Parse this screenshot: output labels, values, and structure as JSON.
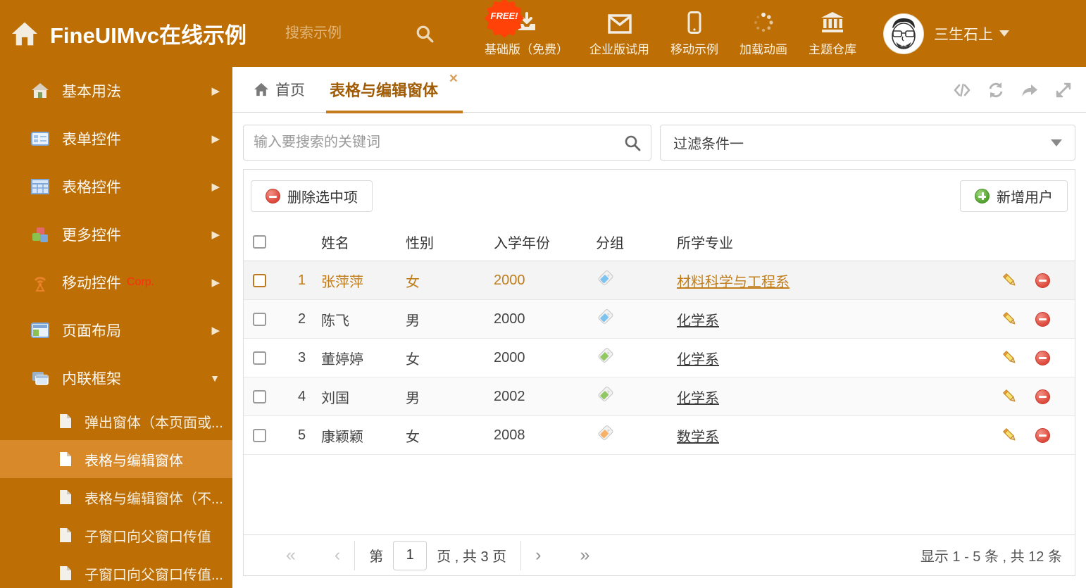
{
  "theme": {
    "header_bg": "#bd6e04",
    "sidebar_active_bg": "#d8892a",
    "free_badge_red": "#ff4208",
    "tab_active_color": "#a05c04",
    "selected_row_color": "#c07d1a"
  },
  "header": {
    "title": "FineUIMvc在线示例",
    "search_placeholder": "搜索示例",
    "free_badge": "FREE!",
    "nav": [
      {
        "label": "基础版（免费）",
        "icon": "download-icon"
      },
      {
        "label": "企业版试用",
        "icon": "envelope-icon"
      },
      {
        "label": "移动示例",
        "icon": "mobile-icon"
      },
      {
        "label": "加载动画",
        "icon": "spinner-icon"
      },
      {
        "label": "主题仓库",
        "icon": "bank-icon"
      }
    ],
    "username": "三生石上"
  },
  "sidebar": {
    "items": [
      {
        "label": "基本用法"
      },
      {
        "label": "表单控件"
      },
      {
        "label": "表格控件"
      },
      {
        "label": "更多控件"
      },
      {
        "label": "移动控件",
        "badge": "Corp."
      },
      {
        "label": "页面布局"
      },
      {
        "label": "内联框架"
      }
    ],
    "children": [
      {
        "label": "弹出窗体（本页面或..."
      },
      {
        "label": "表格与编辑窗体",
        "active": true
      },
      {
        "label": "表格与编辑窗体（不..."
      },
      {
        "label": "子窗口向父窗口传值"
      },
      {
        "label": "子窗口向父窗口传值..."
      }
    ]
  },
  "tabs": {
    "home": "首页",
    "active": "表格与编辑窗体"
  },
  "filter": {
    "search_placeholder": "输入要搜索的关键词",
    "dropdown_value": "过滤条件一"
  },
  "toolbar": {
    "delete_button": "删除选中项",
    "add_button": "新增用户"
  },
  "table": {
    "columns": [
      "姓名",
      "性别",
      "入学年份",
      "分组",
      "所学专业"
    ],
    "rows": [
      {
        "index": "1",
        "name": "张萍萍",
        "gender": "女",
        "year": "2000",
        "tag_color": "#7cc3ef",
        "major": "材料科学与工程系",
        "selected": true
      },
      {
        "index": "2",
        "name": "陈飞",
        "gender": "男",
        "year": "2000",
        "tag_color": "#7cc3ef",
        "major": "化学系",
        "selected": false
      },
      {
        "index": "3",
        "name": "董婷婷",
        "gender": "女",
        "year": "2000",
        "tag_color": "#93c763",
        "major": "化学系",
        "selected": false
      },
      {
        "index": "4",
        "name": "刘国",
        "gender": "男",
        "year": "2002",
        "tag_color": "#93c763",
        "major": "化学系",
        "selected": false
      },
      {
        "index": "5",
        "name": "康颖颖",
        "gender": "女",
        "year": "2008",
        "tag_color": "#f6b26b",
        "major": "数学系",
        "selected": false
      }
    ]
  },
  "pagination": {
    "page_prefix": "第",
    "page_value": "1",
    "page_suffix": "页 , 共 3 页",
    "summary": "显示 1 - 5 条 , 共 12 条"
  }
}
